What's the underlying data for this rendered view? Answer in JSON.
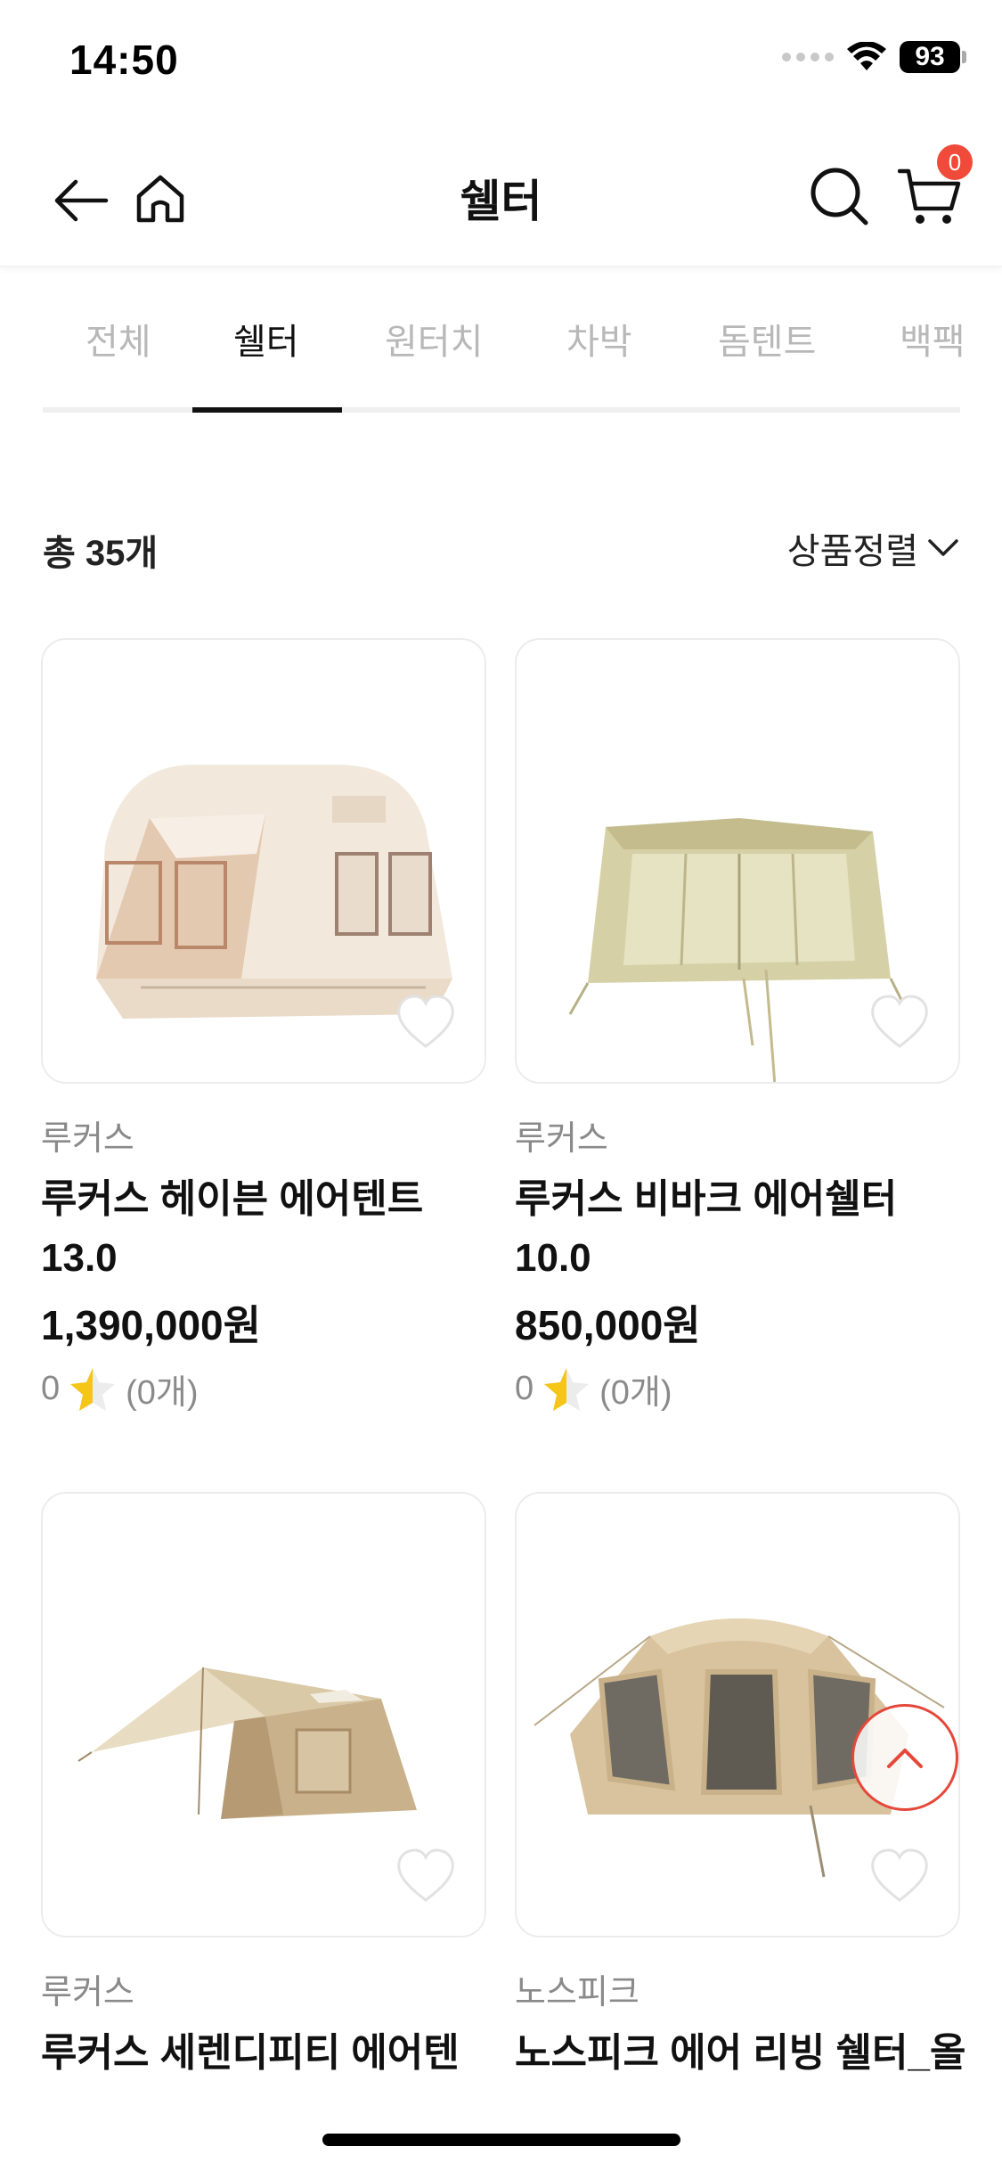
{
  "status": {
    "time": "14:50",
    "battery": "93"
  },
  "header": {
    "title": "쉘터",
    "cart_count": "0"
  },
  "tabs": [
    {
      "label": "전체"
    },
    {
      "label": "쉘터"
    },
    {
      "label": "원터치"
    },
    {
      "label": "차박"
    },
    {
      "label": "돔텐트"
    },
    {
      "label": "백팩"
    }
  ],
  "listing": {
    "total": "총 35개",
    "sort_label": "상품정렬"
  },
  "products": [
    {
      "brand": "루커스",
      "name_line1": "루커스 헤이븐 에어텐트",
      "name_line2": "13.0",
      "price": "1,390,000원",
      "rating": "0",
      "reviews": "(0개)"
    },
    {
      "brand": "루커스",
      "name_line1": "루커스 비바크 에어쉘터",
      "name_line2": "10.0",
      "price": "850,000원",
      "rating": "0",
      "reviews": "(0개)"
    },
    {
      "brand": "루커스",
      "name_line1": "루커스 세렌디피티 에어텐"
    },
    {
      "brand": "노스피크",
      "name_line1": "노스피크 에어 리빙 쉘터_올"
    }
  ],
  "colors": {
    "accent": "#f04a3a",
    "star": "#f5c518",
    "tent_cream": "#efe3d6",
    "tent_olive": "#cfc89c",
    "tent_beige": "#d9c9a6"
  }
}
